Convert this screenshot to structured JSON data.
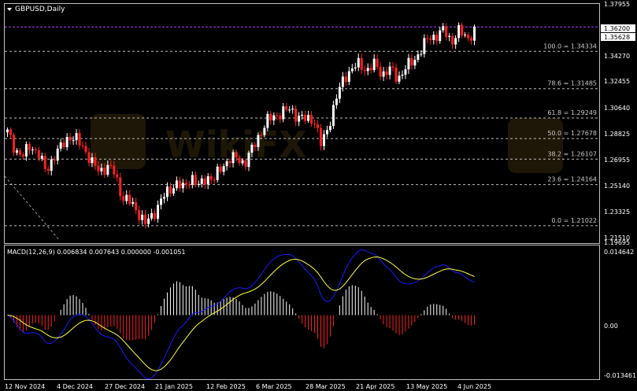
{
  "symbol": "GBPUSD,Daily",
  "macd_label": "MACD(12,26,9) 0.006834 0.007643 0.000000 -0.001051",
  "price_axis": [
    "1.37955",
    "1.36200",
    "1.35628",
    "1.34270",
    "1.32455",
    "1.30640",
    "1.28825",
    "1.26955",
    "1.25140",
    "1.23325",
    "1.21510",
    "1.19695"
  ],
  "current_price": "1.35628",
  "high_line_price": "1.36200",
  "fib_levels": [
    {
      "label": "100.0 = 1.34334",
      "price": 1.34334
    },
    {
      "label": "78.6 = 1.31485",
      "price": 1.31485
    },
    {
      "label": "61.8 = 1.29249",
      "price": 1.29249
    },
    {
      "label": "50.0 = 1.27678",
      "price": 1.27678
    },
    {
      "label": "38.2 = 1.26107",
      "price": 1.26107
    },
    {
      "label": "23.6 = 1.24164",
      "price": 1.24164
    },
    {
      "label": "0.0 = 1.21022",
      "price": 1.21022
    }
  ],
  "macd_axis": [
    "0.014642",
    "0.00",
    "-0.013461"
  ],
  "date_axis": [
    "12 Nov 2024",
    "4 Dec 2024",
    "27 Dec 2024",
    "21 Jan 2025",
    "12 Feb 2025",
    "6 Mar 2025",
    "28 Mar 2025",
    "21 Apr 2025",
    "13 May 2025",
    "4 Jun 2025"
  ],
  "chart_data": {
    "type": "candlestick",
    "price_range": [
      1.19695,
      1.37955
    ],
    "macd_range": [
      -0.013461,
      0.014642
    ],
    "colors": {
      "bull": "#ffffff",
      "bear": "#ff2020",
      "fib": "#bdbdbd",
      "high_line": "#b040ff",
      "macd_main": "#1a1aff",
      "signal": "#ffff40",
      "hist_pos": "#ffffff",
      "hist_neg": "#ff2020"
    },
    "close_path": [
      1.2815,
      1.2685,
      1.2632,
      1.2718,
      1.2654,
      1.2518,
      1.2625,
      1.2702,
      1.2788,
      1.2755,
      1.2698,
      1.2582,
      1.2518,
      1.2555,
      1.2505,
      1.2318,
      1.228,
      1.2215,
      1.2115,
      1.2185,
      1.2292,
      1.2365,
      1.2432,
      1.2382,
      1.2485,
      1.2395,
      1.248,
      1.2455,
      1.2555,
      1.2612,
      1.2615,
      1.258,
      1.269,
      1.281,
      1.2905,
      1.2945,
      1.297,
      1.2995,
      1.293,
      1.2912,
      1.2925,
      1.271,
      1.288,
      1.308,
      1.3245,
      1.3295,
      1.334,
      1.3288,
      1.3335,
      1.326,
      1.3295,
      1.3228,
      1.3305,
      1.3358,
      1.3445,
      1.3535,
      1.3555,
      1.3592,
      1.351,
      1.3588,
      1.3535,
      1.3582
    ]
  }
}
